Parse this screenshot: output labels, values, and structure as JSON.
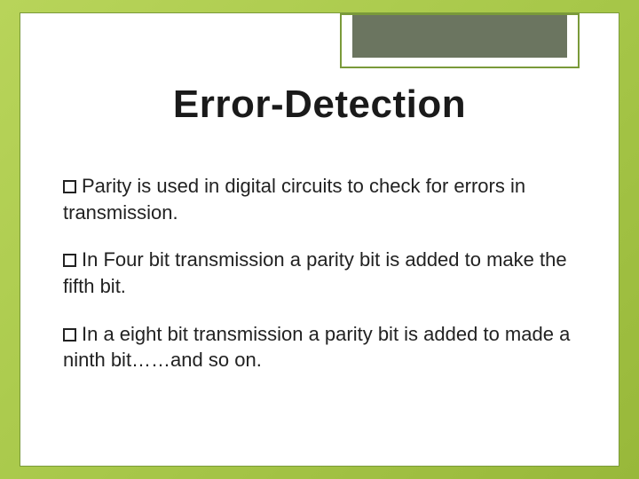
{
  "title": "Error-Detection",
  "bullets": [
    "Parity is used in digital circuits to check for errors in transmission.",
    "In Four bit transmission a parity bit is added to make the fifth bit.",
    "In a eight bit transmission a parity bit is added to made a ninth bit……and so on."
  ]
}
